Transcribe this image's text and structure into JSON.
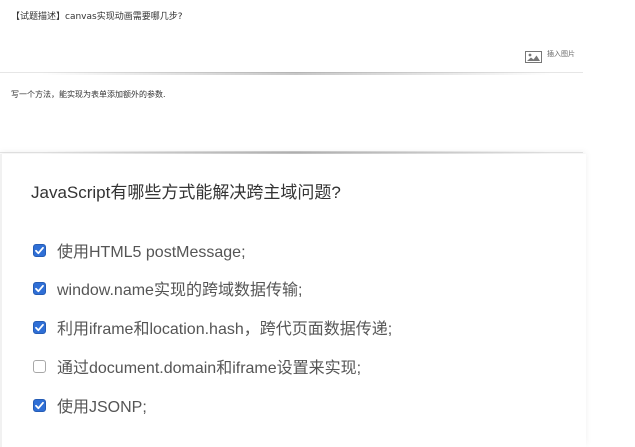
{
  "editor": {
    "title": "【试题描述】canvas实现动画需要哪几步?",
    "insert_image_label": "插入图片",
    "body_text": "写一个方法，能实现为表单添加额外的参数."
  },
  "question": {
    "title": "JavaScript有哪些方式能解决跨主域问题?",
    "options": [
      {
        "label": "使用HTML5 postMessage;",
        "checked": true
      },
      {
        "label": "window.name实现的跨域数据传输;",
        "checked": true
      },
      {
        "label": "利用iframe和location.hash，跨代页面数据传递;",
        "checked": true
      },
      {
        "label": "通过document.domain和iframe设置来实现;",
        "checked": false
      },
      {
        "label": "使用JSONP;",
        "checked": true
      }
    ]
  },
  "colors": {
    "checkbox_checked": "#2f6fd6",
    "text_primary": "#333333",
    "text_option": "#555555"
  }
}
